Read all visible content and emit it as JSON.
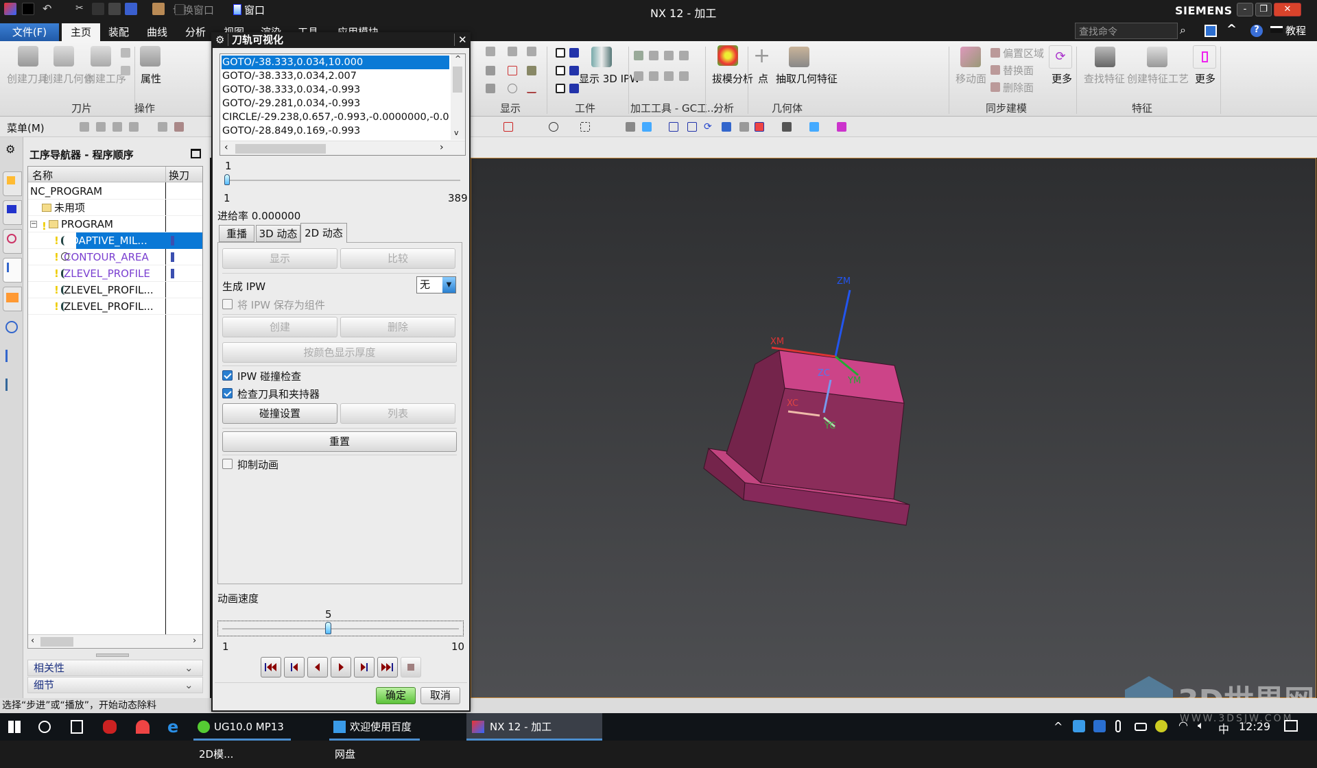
{
  "window": {
    "title": "NX 12 - 加工",
    "brand": "SIEMENS",
    "quick_access": {
      "switch_window": "切换窗口",
      "window_menu": "窗口"
    },
    "buttons": {
      "minimize": "-",
      "restore": "❐",
      "close": "✕"
    }
  },
  "menu_tabs": [
    "文件(F)",
    "主页",
    "装配",
    "曲线",
    "分析",
    "视图",
    "渲染",
    "工具",
    "应用模块"
  ],
  "active_tab": "主页",
  "search": {
    "placeholder": "查找命令"
  },
  "help": {
    "tutorial": "教程"
  },
  "ribbon": {
    "create_tool": "创建刀具",
    "create_geometry": "创建几何体",
    "create_operation": "创建工序",
    "attributes": "属性",
    "group_insert": "刀片",
    "group_operation": "操作",
    "group_display": "显示",
    "show_3d_ipw": "显示 3D IPW",
    "group_workpiece": "工件",
    "group_gc_tools": "加工工具 - GC工...",
    "draft_analysis": "拔模分析",
    "group_analysis": "分析",
    "point": "点",
    "extract_geometry": "抽取几何特征",
    "group_geometry": "几何体",
    "move_face": "移动面",
    "offset_region": "偏置区域",
    "replace_face": "替换面",
    "delete_face": "删除面",
    "more": "更多",
    "group_sync_modeling": "同步建模",
    "find_feature": "查找特征",
    "create_feature_process": "创建特征工艺",
    "group_feature": "特征"
  },
  "toolbar2": {
    "menu": "菜单(M)"
  },
  "navigator": {
    "title": "工序导航器 - 程序顺序",
    "columns": [
      "名称",
      "换刀"
    ],
    "rows": [
      {
        "name": "NC_PROGRAM",
        "level": 0
      },
      {
        "name": "未用项",
        "level": 1
      },
      {
        "name": "PROGRAM",
        "level": 1
      },
      {
        "name": "ADAPTIVE_MIL...",
        "level": 2,
        "selected": true,
        "tool_change": true
      },
      {
        "name": "CONTOUR_AREA",
        "level": 2,
        "tool_change": true,
        "color": "#7a3fd0"
      },
      {
        "name": "ZLEVEL_PROFILE",
        "level": 2,
        "tool_change": true,
        "color": "#7a3fd0"
      },
      {
        "name": "ZLEVEL_PROFIL...",
        "level": 2
      },
      {
        "name": "ZLEVEL_PROFIL...",
        "level": 2
      }
    ],
    "dependencies": "相关性",
    "details": "细节"
  },
  "dialog": {
    "title": "刀轨可视化",
    "path_lines": [
      "GOTO/-38.333,0.034,10.000",
      "GOTO/-38.333,0.034,2.007",
      "GOTO/-38.333,0.034,-0.993",
      "GOTO/-29.281,0.034,-0.993",
      "CIRCLE/-29.238,0.657,-0.993,-0.0000000,-0.00",
      "GOTO/-28.849,0.169,-0.993"
    ],
    "selected_line": 0,
    "position_slider": {
      "value": "1",
      "min": "1",
      "max": "389"
    },
    "feed_rate": "进给率 0.000000",
    "tabs": [
      "重播",
      "3D 动态",
      "2D 动态"
    ],
    "active_tab": "2D 动态",
    "display_btn": "显示",
    "compare_btn": "比较",
    "generate_ipw_label": "生成 IPW",
    "generate_ipw_value": "无",
    "save_ipw_component": "将 IPW 保存为组件",
    "create_btn": "创建",
    "delete_btn": "删除",
    "thickness_by_color_btn": "按颜色显示厚度",
    "ipw_collision_check": "IPW 碰撞检查",
    "ipw_collision_checked": true,
    "check_tool_holder": "检查刀具和夹持器",
    "check_tool_holder_checked": true,
    "collision_settings_btn": "碰撞设置",
    "list_btn": "列表",
    "reset_btn": "重置",
    "suppress_animation": "抑制动画",
    "suppress_animation_checked": false,
    "animation_speed_label": "动画速度",
    "speed_slider": {
      "value": "5",
      "min": "1",
      "max": "10"
    },
    "ok_btn": "确定",
    "cancel_btn": "取消"
  },
  "viewport": {
    "axes": {
      "zm": "ZM",
      "xm": "XM",
      "ym": "YM",
      "zc": "ZC",
      "xc": "XC",
      "yc": "YC"
    },
    "part_color": "#cc4488",
    "watermark": "3D世界网",
    "watermark_url": "WWW.3DSJW.COM"
  },
  "status_bar": {
    "message": "选择“步进”或“播放”，开始动态除料"
  },
  "taskbar": {
    "apps": [
      "UG10.0 MP13 2D模...",
      "欢迎使用百度网盘",
      "NX 12 - 加工"
    ],
    "ime": "中",
    "time": "12:29"
  }
}
